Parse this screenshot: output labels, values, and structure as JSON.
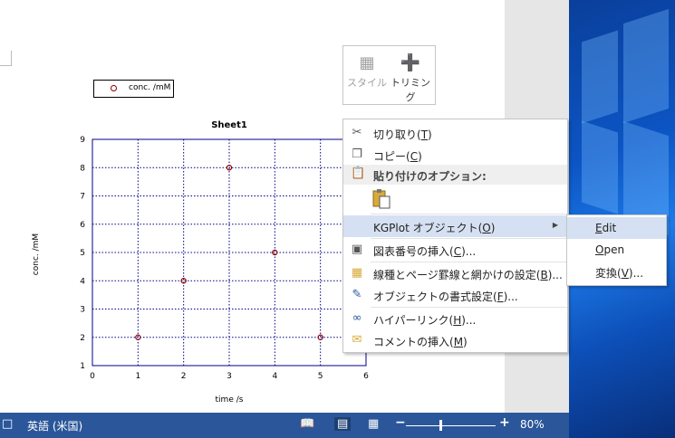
{
  "chart_data": {
    "type": "scatter",
    "title": "Sheet1",
    "xlabel": "time /s",
    "ylabel": "conc. /mM",
    "xlim": [
      0,
      6
    ],
    "ylim": [
      1,
      9
    ],
    "grid": true,
    "legend_position": "top-left",
    "xticks": [
      0,
      1,
      2,
      3,
      4,
      5,
      6
    ],
    "yticks": [
      1,
      2,
      3,
      4,
      5,
      6,
      7,
      8,
      9
    ],
    "series": [
      {
        "name": "conc. /mM",
        "color": "#8b0000",
        "marker": "circle",
        "x": [
          1,
          2,
          3,
          4,
          5
        ],
        "y": [
          2,
          4,
          8,
          5,
          2
        ]
      }
    ]
  },
  "colors": {
    "axis": "#00008b",
    "grid": "#00008b",
    "marker": "#8b0000",
    "statusbar": "#2b579a",
    "highlight": "#d5e1f2"
  },
  "mini_toolbar": {
    "style_label": "スタイル",
    "style_icon": "style-icon",
    "trim_label": "トリミング",
    "trim_icon": "crop-icon"
  },
  "context_menu": {
    "cut": {
      "text": "切り取り(",
      "key": "T",
      "suffix": ")",
      "icon": "scissors-icon"
    },
    "copy": {
      "text": "コピー(",
      "key": "C",
      "suffix": ")",
      "icon": "copy-icon"
    },
    "paste_header": "貼り付けのオプション:",
    "paste_icon": "paste-icon",
    "kgplot": {
      "text": "KGPlot  オブジェクト(",
      "key": "O",
      "suffix": ")"
    },
    "caption": {
      "text": "図表番号の挿入(",
      "key": "C",
      "suffix": ")..."
    },
    "borders": {
      "text": "線種とページ罫線と網かけの設定(",
      "key": "B",
      "suffix": ")..."
    },
    "format": {
      "text": "オブジェクトの書式設定(",
      "key": "F",
      "suffix": ")..."
    },
    "hyperlink": {
      "text": "ハイパーリンク(",
      "key": "H",
      "suffix": ")..."
    },
    "comment": {
      "text": "コメントの挿入(",
      "key": "M",
      "suffix": ")"
    }
  },
  "submenu": {
    "edit": {
      "key": "E",
      "rest": "dit"
    },
    "open": {
      "key": "O",
      "rest": "pen"
    },
    "convert": {
      "text": "変換(",
      "key": "V",
      "suffix": ")..."
    }
  },
  "statusbar": {
    "language": "英語 (米国)",
    "zoom_minus": "−",
    "zoom_plus": "+",
    "zoom_level": "80%",
    "zoom_value": 80
  }
}
